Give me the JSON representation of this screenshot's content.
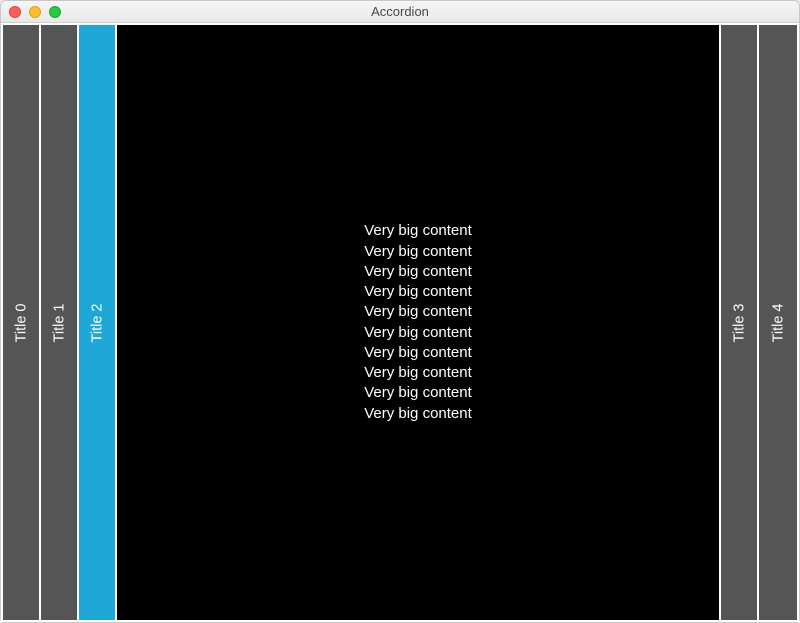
{
  "window": {
    "title": "Accordion"
  },
  "accordion": {
    "selected_index": 2,
    "panels": [
      {
        "label": "Title 0"
      },
      {
        "label": "Title 1"
      },
      {
        "label": "Title 2"
      },
      {
        "label": "Title 3"
      },
      {
        "label": "Title 4"
      }
    ],
    "content_lines": [
      "Very big content",
      "Very big content",
      "Very big content",
      "Very big content",
      "Very big content",
      "Very big content",
      "Very big content",
      "Very big content",
      "Very big content",
      "Very big content"
    ]
  },
  "colors": {
    "tab_bg": "#555555",
    "tab_selected_bg": "#1fa7d7",
    "content_bg": "#000000"
  }
}
